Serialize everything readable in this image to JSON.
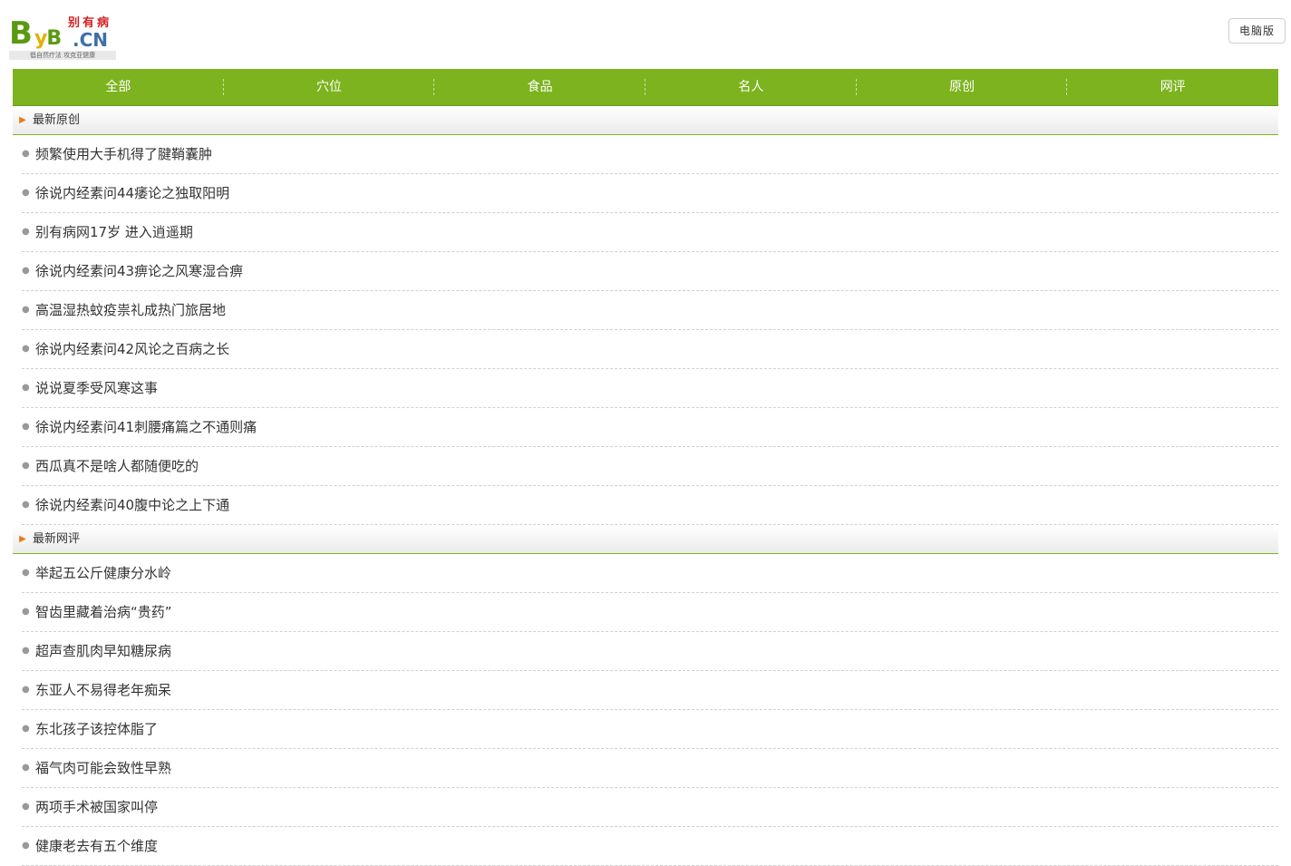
{
  "header": {
    "logo": {
      "latin_b": "B",
      "latin_y": "y",
      "latin_b2": "B",
      "latin_cn": ".CN",
      "chinese_name": "别有病",
      "slogan": "倡自然疗法 攻克亚健康"
    },
    "pc_version_label": "电脑版"
  },
  "nav": {
    "items": [
      "全部",
      "穴位",
      "食品",
      "名人",
      "原创",
      "网评"
    ]
  },
  "colors": {
    "accent_green": "#7cb31e",
    "arrow_orange": "#e57c1a"
  },
  "sections": [
    {
      "title": "最新原创",
      "items": [
        "频繁使用大手机得了腱鞘囊肿",
        "徐说内经素问44痿论之独取阳明",
        "别有病网17岁 进入逍遥期",
        "徐说内经素问43痹论之风寒湿合痹",
        "高温湿热蚊疫祟礼成热门旅居地",
        "徐说内经素问42风论之百病之长",
        "说说夏季受风寒这事",
        "徐说内经素问41刺腰痛篇之不通则痛",
        "西瓜真不是啥人都随便吃的",
        "徐说内经素问40腹中论之上下通"
      ]
    },
    {
      "title": "最新网评",
      "items": [
        "举起五公斤健康分水岭",
        "智齿里藏着治病“贵药”",
        "超声查肌肉早知糖尿病",
        "东亚人不易得老年痴呆",
        "东北孩子该控体脂了",
        "福气肉可能会致性早熟",
        "两项手术被国家叫停",
        "健康老去有五个维度"
      ]
    }
  ]
}
